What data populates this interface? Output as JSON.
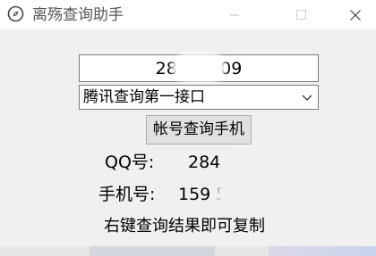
{
  "window": {
    "title": "离殇查询助手",
    "icon": "compass-icon"
  },
  "titlebar_buttons": {
    "minimize": "minimize-icon",
    "maximize": "maximize-icon",
    "close": "close-icon"
  },
  "form": {
    "qq_input_value": "284    409",
    "api_select_value": "腾讯查询第一接口",
    "query_button_label": "帐号查询手机"
  },
  "result": {
    "qq_label": "QQ号:",
    "qq_value": "284    409",
    "phone_label": "手机号:",
    "phone_value": "159      560",
    "hint": "右键查询结果即可复制"
  },
  "colors": {
    "window_bg": "#f0f0f0",
    "titlebar_bg": "#ffffff",
    "button_bg": "#e1e1e1"
  }
}
